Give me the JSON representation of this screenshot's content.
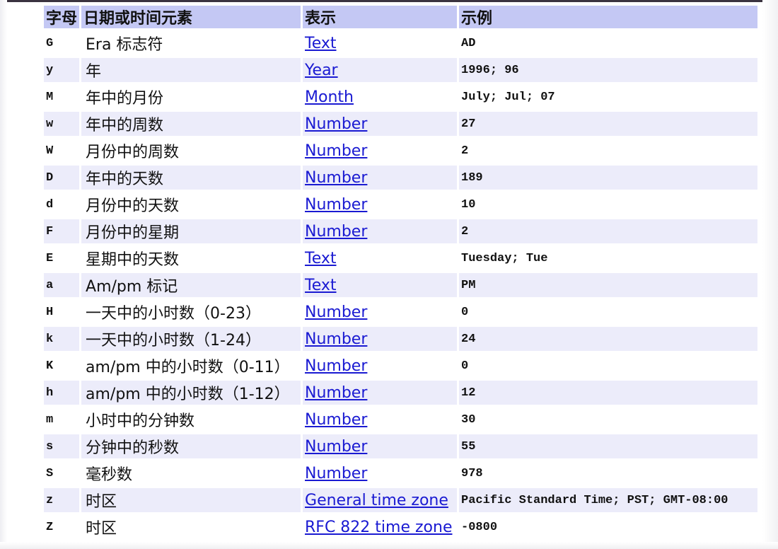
{
  "table": {
    "headers": [
      "字母",
      "日期或时间元素",
      "表示",
      "示例"
    ],
    "rows": [
      {
        "letter": "G",
        "element": "Era 标志符",
        "presentation": "Text",
        "example": "AD"
      },
      {
        "letter": "y",
        "element": "年",
        "presentation": "Year",
        "example": "1996; 96"
      },
      {
        "letter": "M",
        "element": "年中的月份",
        "presentation": "Month",
        "example": "July; Jul; 07"
      },
      {
        "letter": "w",
        "element": "年中的周数",
        "presentation": "Number",
        "example": "27"
      },
      {
        "letter": "W",
        "element": "月份中的周数",
        "presentation": "Number",
        "example": "2"
      },
      {
        "letter": "D",
        "element": "年中的天数",
        "presentation": "Number",
        "example": "189"
      },
      {
        "letter": "d",
        "element": "月份中的天数",
        "presentation": "Number",
        "example": "10"
      },
      {
        "letter": "F",
        "element": "月份中的星期",
        "presentation": "Number",
        "example": "2"
      },
      {
        "letter": "E",
        "element": "星期中的天数",
        "presentation": "Text",
        "example": "Tuesday; Tue"
      },
      {
        "letter": "a",
        "element": "Am/pm 标记",
        "presentation": "Text",
        "example": "PM"
      },
      {
        "letter": "H",
        "element": "一天中的小时数（0-23）",
        "presentation": "Number",
        "example": "0"
      },
      {
        "letter": "k",
        "element": "一天中的小时数（1-24）",
        "presentation": "Number",
        "example": "24"
      },
      {
        "letter": "K",
        "element": "am/pm 中的小时数（0-11）",
        "presentation": "Number",
        "example": "0"
      },
      {
        "letter": "h",
        "element": "am/pm 中的小时数（1-12）",
        "presentation": "Number",
        "example": "12"
      },
      {
        "letter": "m",
        "element": "小时中的分钟数",
        "presentation": "Number",
        "example": "30"
      },
      {
        "letter": "s",
        "element": "分钟中的秒数",
        "presentation": "Number",
        "example": "55"
      },
      {
        "letter": "S",
        "element": "毫秒数",
        "presentation": "Number",
        "example": "978"
      },
      {
        "letter": "z",
        "element": "时区",
        "presentation": "General time zone",
        "example": "Pacific Standard Time; PST; GMT-08:00"
      },
      {
        "letter": "Z",
        "element": "时区",
        "presentation": "RFC 822 time zone",
        "example": "-0800"
      }
    ]
  },
  "colors": {
    "header_bg": "#c4c8f4",
    "alt_row_bg": "#ececfa",
    "link": "#1a1ad2"
  }
}
